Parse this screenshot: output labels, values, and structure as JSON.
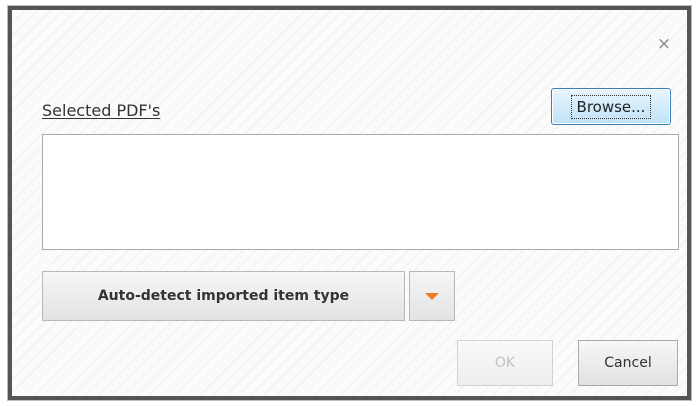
{
  "dialog": {
    "close_glyph": "×",
    "selected_label": "Selected PDF's",
    "browse_label": "Browse...",
    "pdf_list": [],
    "import_type_label": "Auto-detect imported item type",
    "ok_label": "OK",
    "ok_enabled": false,
    "cancel_label": "Cancel"
  },
  "icons": {
    "close": "close-icon",
    "dropdown": "caret-down-icon"
  },
  "colors": {
    "accent": "#ee7a24",
    "browse_border": "#3b7fb6",
    "frame": "#555555"
  }
}
